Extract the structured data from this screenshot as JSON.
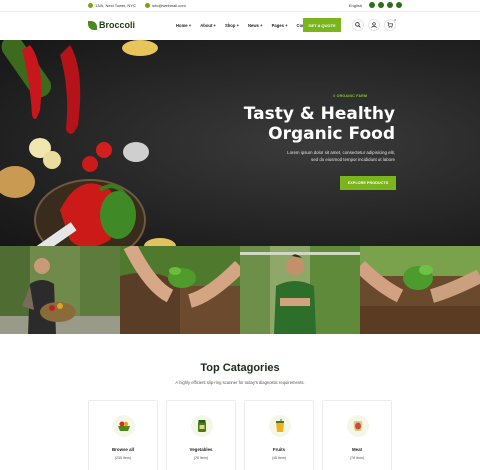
{
  "topbar": {
    "address": "13/A, Next Tower, NYC",
    "email": "info@webmail.com",
    "language": "English",
    "social": [
      "facebook-icon",
      "twitter-icon",
      "youtube-icon",
      "pinterest-icon"
    ]
  },
  "header": {
    "logo_text": "Broccoli",
    "nav": [
      "Home +",
      "About +",
      "Shop +",
      "News +",
      "Pages +",
      "Contact"
    ],
    "quote_label": "GET A QUOTE",
    "cart_count": "0"
  },
  "hero": {
    "tagline": "// ORGANIC FARM",
    "title_line1": "Tasty & Healthy",
    "title_line2": "Organic Food",
    "subtitle_line1": "Lorem ipsum dolor sit amet, consectetur adipisicing elit,",
    "subtitle_line2": "sed do eiusmod tempor incididunt ut labore",
    "cta_label": "EXPLORE PRODUCTS",
    "slides": 2,
    "active_slide": 1
  },
  "categories": {
    "title": "Top Catagories",
    "subtitle": "A highly efficient slip-ring scanner for today's diagnostic requirements.",
    "items": [
      {
        "name": "Browse all",
        "count": "(235 Item)",
        "icon": "fruit-basket-icon"
      },
      {
        "name": "Vegetables",
        "count": "(78 Item)",
        "icon": "vegetable-jar-icon"
      },
      {
        "name": "Fruits",
        "count": "(45 Item)",
        "icon": "juice-cup-icon"
      },
      {
        "name": "Meat",
        "count": "(78 Item)",
        "icon": "meat-icon"
      }
    ]
  },
  "colors": {
    "accent": "#7ab51d",
    "dark_green": "#1c3d10",
    "hero_bg": "#262626"
  }
}
